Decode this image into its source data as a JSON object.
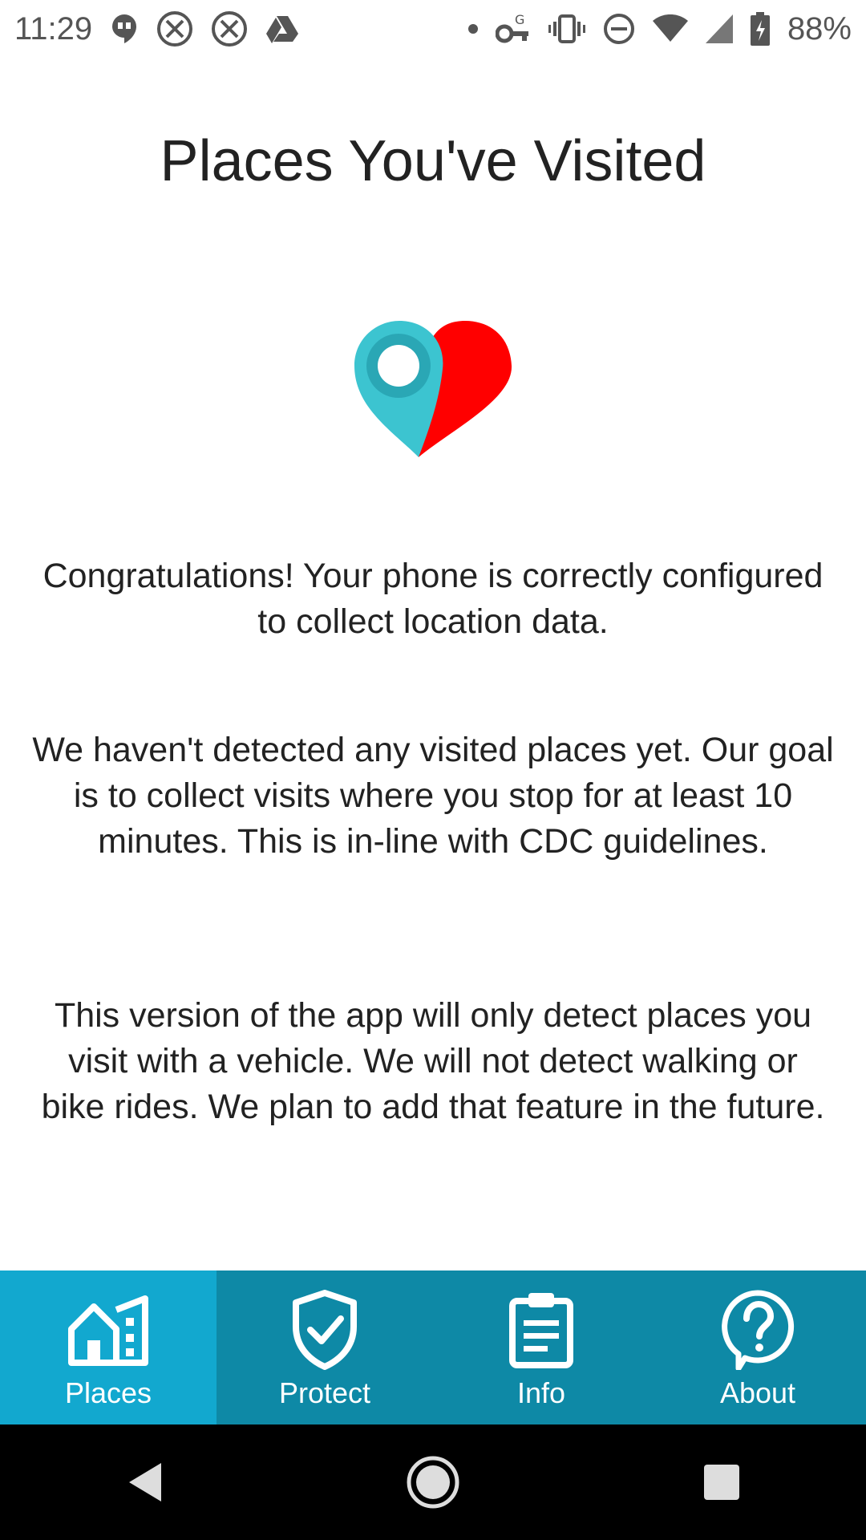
{
  "status_bar": {
    "time": "11:29",
    "battery_percent": "88%",
    "icons_left": [
      "hangouts-icon",
      "x-circle-icon",
      "x-circle-icon",
      "drive-icon"
    ],
    "icons_right": [
      "dot-icon",
      "vpn-key-icon",
      "vibrate-icon",
      "do-not-disturb-icon",
      "wifi-icon",
      "cell-signal-icon",
      "battery-charging-icon"
    ]
  },
  "page": {
    "title": "Places You've Visited",
    "hero_icon": "location-heart-icon",
    "paragraphs": [
      "Congratulations! Your phone is correctly configured to collect location data.",
      "We haven't detected any visited places yet. Our goal is to collect visits where you stop for at least 10 minutes. This is in-line with CDC guidelines.",
      "This version of the app will only detect places you visit with a vehicle. We will not detect walking or bike rides. We plan to add that feature in the future."
    ]
  },
  "bottom_nav": {
    "items": [
      {
        "label": "Places",
        "icon": "buildings-icon",
        "active": true
      },
      {
        "label": "Protect",
        "icon": "shield-check-icon",
        "active": false
      },
      {
        "label": "Info",
        "icon": "clipboard-icon",
        "active": false
      },
      {
        "label": "About",
        "icon": "help-circle-icon",
        "active": false
      }
    ]
  },
  "colors": {
    "nav_background": "#0e89a6",
    "nav_active": "#12a8cf",
    "pin_teal": "#3cc4d0",
    "heart_red": "#ff0000"
  }
}
